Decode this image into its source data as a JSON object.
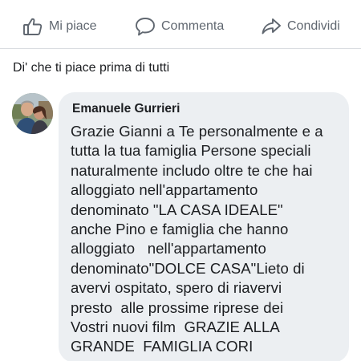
{
  "actions": {
    "like_label": "Mi piace",
    "comment_label": "Commenta",
    "share_label": "Condividi",
    "like_icon": "thumbs-up-icon",
    "comment_icon": "speech-bubble-icon",
    "share_icon": "share-arrow-icon"
  },
  "first_like_prompt": "Di' che ti piace prima di tutti",
  "comment": {
    "author": "Emanuele Gurrieri",
    "text": "Grazie Gianni a Te personalmente e a\ntutta la tua famiglia Persone speciali\nnaturalmente includo oltre te che hai\nalloggiato nell'appartamento\ndenominato \"LA CASA IDEALE\"\nanche Pino e famiglia che hanno\nalloggiato   nell'appartamento\ndenominato\"DOLCE CASA\"Lieto di\navervi ospitato, spero di riavervi\npresto  alle prossime riprese dei\nVostri nuovi film  GRAZIE ALLA\nGRANDE  FAMIGLIA CORI"
  },
  "colors": {
    "action_text": "#606770",
    "bubble_bg": "#eceff2",
    "text": "#1c1e21"
  }
}
